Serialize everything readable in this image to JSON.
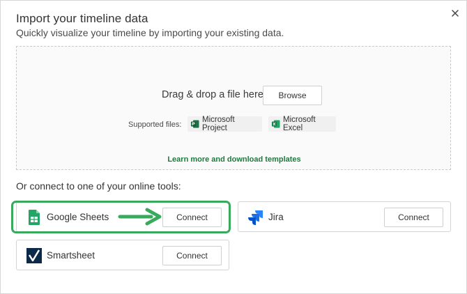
{
  "dialog": {
    "title": "Import your timeline data",
    "subtitle": "Quickly visualize your timeline by importing your existing data.",
    "close_icon": "close-icon"
  },
  "dropzone": {
    "drag_text": "Drag & drop a file here or",
    "browse_label": "Browse",
    "supported_label": "Supported files:",
    "files": [
      {
        "label": "Microsoft Project",
        "icon": "ms-project-icon"
      },
      {
        "label": "Microsoft Excel",
        "icon": "ms-excel-icon"
      }
    ],
    "learn_more": "Learn more and download templates"
  },
  "online_tools": {
    "heading": "Or connect to one of your online tools:",
    "tools": [
      {
        "name": "Google Sheets",
        "icon": "google-sheets-icon",
        "connect_label": "Connect"
      },
      {
        "name": "Jira",
        "icon": "jira-icon",
        "connect_label": "Connect"
      },
      {
        "name": "Smartsheet",
        "icon": "smartsheet-icon",
        "connect_label": "Connect"
      }
    ]
  },
  "colors": {
    "accent_green": "#1f7a3e",
    "highlight_green": "#39a95b",
    "jira_blue": "#2684ff",
    "smartsheet_navy": "#0b2a4a",
    "sheets_green": "#23a566"
  }
}
